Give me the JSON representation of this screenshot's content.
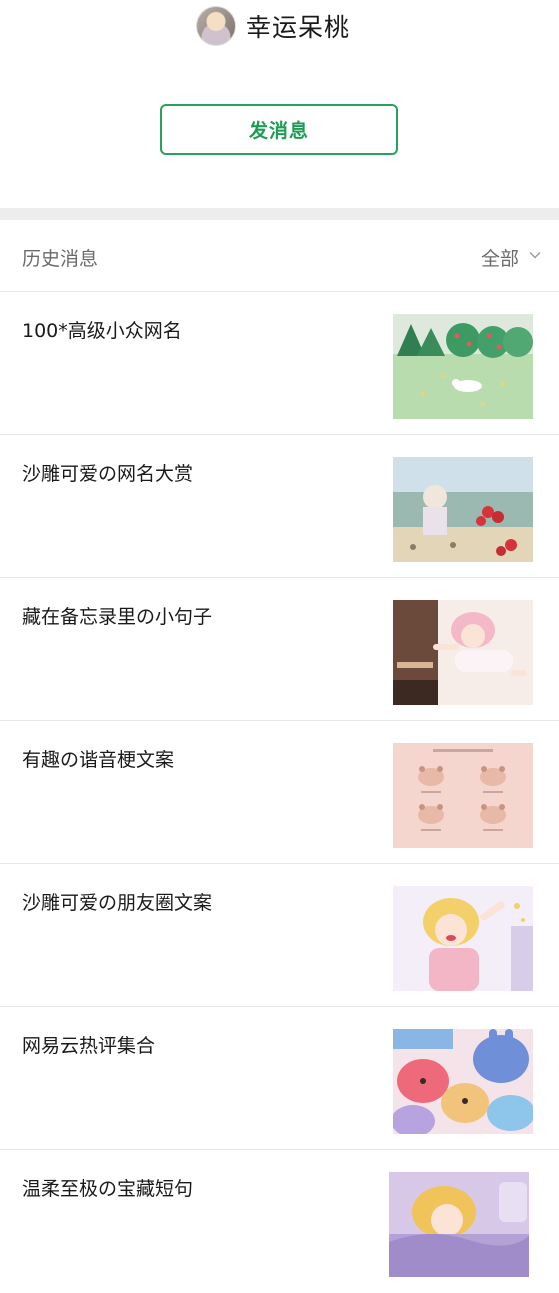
{
  "account": {
    "name": "幸运呆桃",
    "avatar_icon": "avatar-image"
  },
  "actions": {
    "send_message": "发消息"
  },
  "history": {
    "title": "历史消息",
    "filter_label": "全部",
    "filter_icon": "chevron-down-icon"
  },
  "articles": [
    {
      "title": "100*高级小众网名",
      "thumb": "forest-bunny-illustration"
    },
    {
      "title": "沙雕可爱の网名大赏",
      "thumb": "anime-girl-flowers-illustration"
    },
    {
      "title": "藏在备忘录里の小句子",
      "thumb": "anime-girl-flying-illustration"
    },
    {
      "title": "有趣の谐音梗文案",
      "thumb": "four-bears-illustration"
    },
    {
      "title": "沙雕可爱の朋友圈文案",
      "thumb": "anime-girl-cheering-illustration"
    },
    {
      "title": "网易云热评集合",
      "thumb": "care-bears-illustration"
    },
    {
      "title": "温柔至极の宝藏短句",
      "thumb": "anime-girl-sleeping-illustration"
    }
  ],
  "colors": {
    "accent_green": "#1c9d54",
    "divider_gray": "#ededed"
  }
}
